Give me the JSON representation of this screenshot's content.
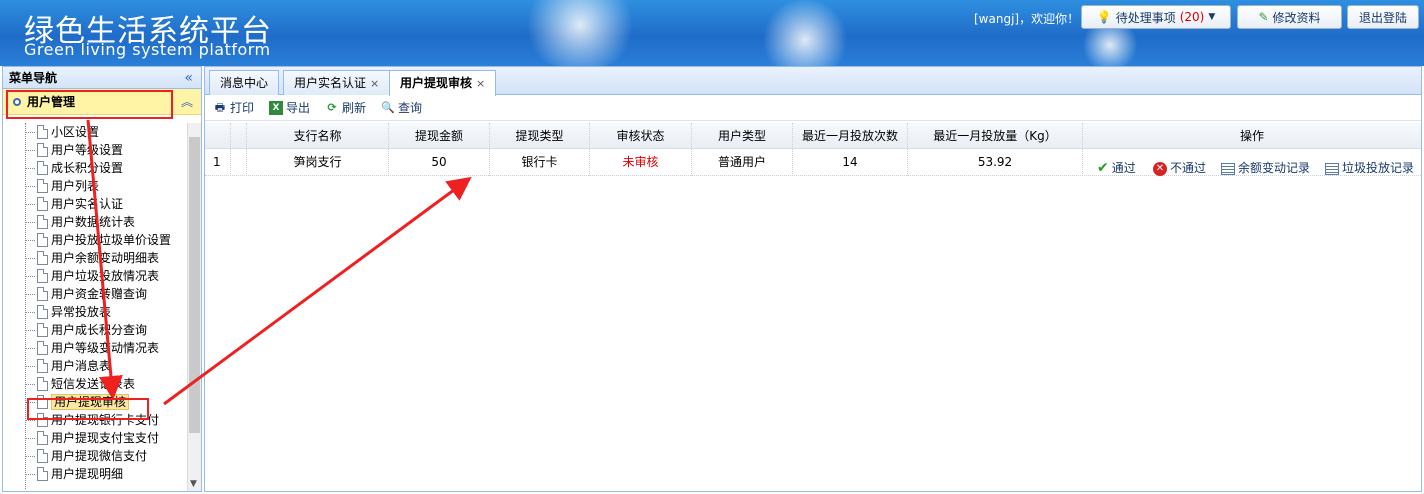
{
  "header": {
    "title": "绿色生活系统平台",
    "subtitle": "Green living system platform",
    "welcome": "[wangj]，欢迎你！",
    "todo_label": "待处理事项",
    "todo_count": "(20)",
    "edit_profile": "修改资料",
    "logout": "退出登陆"
  },
  "sidebar": {
    "title": "菜单导航",
    "collapse_icon": "«",
    "group": "用户管理",
    "group_toggle": "︽",
    "items": [
      "小区设置",
      "用户等级设置",
      "成长积分设置",
      "用户列表",
      "用户实名认证",
      "用户数据统计表",
      "用户投放垃圾单价设置",
      "用户余额变动明细表",
      "用户垃圾投放情况表",
      "用户资金转赠查询",
      "异常投放表",
      "用户成长积分查询",
      "用户等级变动情况表",
      "用户消息表",
      "短信发送记录表",
      "用户提现审核",
      "用户提现银行卡支付",
      "用户提现支付宝支付",
      "用户提现微信支付",
      "用户提现明细"
    ],
    "selected_index": 15
  },
  "tabs": [
    {
      "label": "消息中心",
      "closable": false
    },
    {
      "label": "用户实名认证",
      "closable": true
    },
    {
      "label": "用户提现审核",
      "closable": true,
      "active": true
    }
  ],
  "toolbar": {
    "print": "打印",
    "export": "导出",
    "refresh": "刷新",
    "query": "查询"
  },
  "grid": {
    "columns": [
      "",
      "",
      "支行名称",
      "提现金额",
      "提现类型",
      "审核状态",
      "用户类型",
      "最近一月投放次数",
      "最近一月投放量（Kg）",
      "操作"
    ],
    "rows": [
      {
        "index": "1",
        "branch": "笋岗支行",
        "amount": "50",
        "type": "银行卡",
        "status": "未审核",
        "user_type": "普通用户",
        "drops_count": "14",
        "drops_kg": "53.92"
      }
    ],
    "actions": {
      "approve": "通过",
      "reject": "不通过",
      "balance_log": "余额变动记录",
      "drop_log": "垃圾投放记录"
    }
  },
  "colors": {
    "header_blue": "#1f6cc8",
    "annotation_red": "#ee2020",
    "status_red": "#e00000"
  }
}
